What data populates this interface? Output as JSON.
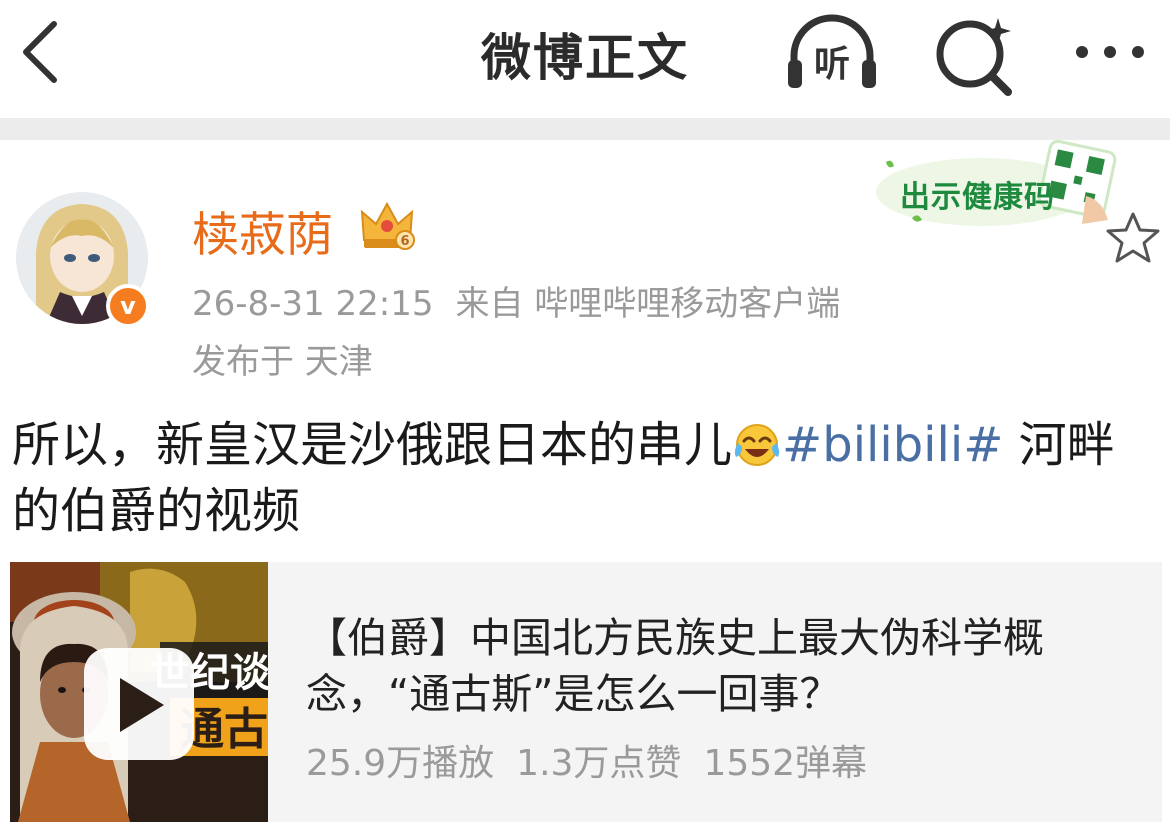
{
  "header": {
    "title": "微博正文",
    "listen_label": "听"
  },
  "post": {
    "username": "椟菽荫",
    "timestamp": "26-8-31 22:15",
    "source": "来自 哔哩哔哩移动客户端",
    "location": "发布于 天津",
    "verified_mark": "v",
    "crown_level": "6",
    "health_code_label": "出示健康码",
    "text_before_emoji": "所以，新皇汉是沙俄跟日本的串儿",
    "topic": "#bilibili#",
    "text_after_topic": " 河畔的伯爵的视频"
  },
  "video_card": {
    "title": "【伯爵】中国北方民族史上最大伪科学概念，“通古斯”是怎么一回事？",
    "thumb_text_1": "世纪谈",
    "thumb_text_2": "通古",
    "views": "25.9万播放",
    "likes": "1.3万点赞",
    "danmaku": "1552弹幕"
  },
  "colors": {
    "accent_orange": "#e86b1a",
    "topic_blue": "#4a6fa5",
    "meta_gray": "#9a9a9a",
    "health_green": "#1d8a3d"
  },
  "icons": [
    "back-arrow-icon",
    "listen-headphones-icon",
    "search-sparkle-icon",
    "more-dots-icon",
    "crown-badge-icon",
    "verified-badge-icon",
    "favorite-star-icon",
    "laugh-cry-emoji",
    "play-icon"
  ]
}
